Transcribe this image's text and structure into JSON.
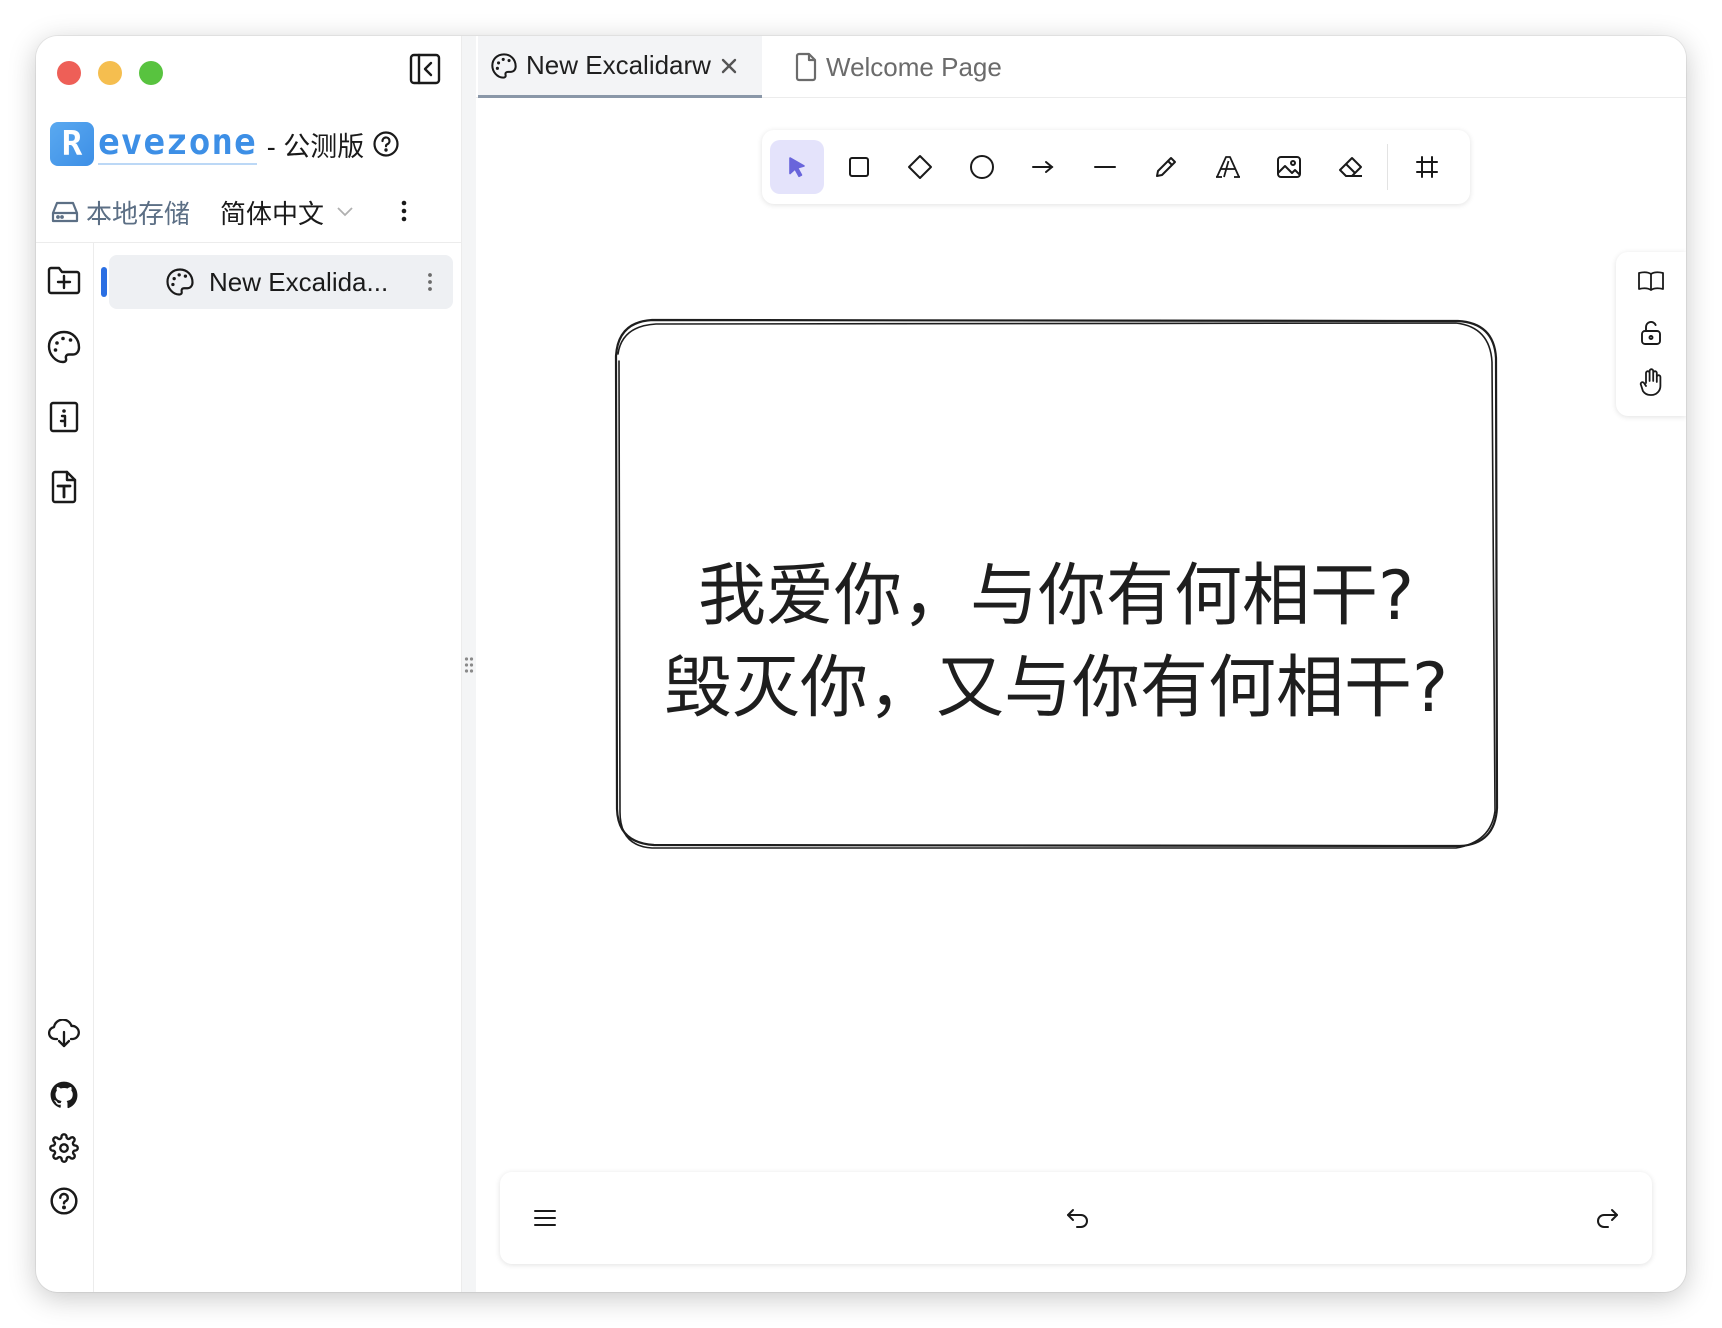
{
  "sidebar": {
    "brand": {
      "letter": "R",
      "rest": "evezone",
      "suffix": "- 公测版"
    },
    "storage_label": "本地存储",
    "language_label": "简体中文",
    "tree": [
      {
        "label": "New Excalida...",
        "icon": "palette-icon"
      }
    ],
    "rail_icons": [
      "add-folder-icon",
      "palette-icon",
      "note-board-icon",
      "text-file-icon"
    ],
    "rail_bottom_icons": [
      "cloud-download-icon",
      "github-icon",
      "gear-icon",
      "help-icon"
    ]
  },
  "tabs": [
    {
      "label": "New Excalidarw",
      "icon": "palette-icon",
      "active": true
    },
    {
      "label": "Welcome Page",
      "icon": "file-icon",
      "active": false
    }
  ],
  "toolbar": {
    "tools": [
      "pointer-icon",
      "rectangle-icon",
      "diamond-icon",
      "ellipse-icon",
      "arrow-icon",
      "line-icon",
      "pencil-icon",
      "text-icon",
      "image-icon",
      "eraser-icon",
      "frame-icon"
    ],
    "active_tool": "pointer-icon",
    "accent": "#6965db"
  },
  "right_panel": [
    "book-icon",
    "unlock-icon",
    "hand-icon"
  ],
  "canvas": {
    "text_line_1": "我爱你，与你有何相干?",
    "text_line_2": "毁灭你，又与你有何相干?"
  },
  "bottom_bar": [
    "menu-icon",
    "undo-icon",
    "redo-icon"
  ]
}
